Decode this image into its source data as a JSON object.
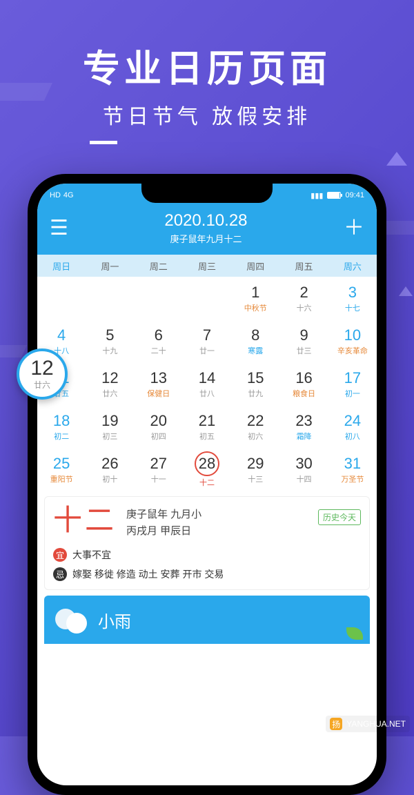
{
  "marketing": {
    "title": "专业日历页面",
    "subtitle": "节日节气 放假安排"
  },
  "statusbar": {
    "hd": "HD",
    "net": "4G",
    "time": "09:41"
  },
  "header": {
    "date": "2020.10.28",
    "lunar": "庚子鼠年九月十二"
  },
  "weekdays": [
    "周日",
    "周一",
    "周二",
    "周三",
    "周四",
    "周五",
    "周六"
  ],
  "badge": {
    "num": "12",
    "sub": "廿六"
  },
  "calendar": [
    {
      "n": "",
      "s": ""
    },
    {
      "n": "",
      "s": ""
    },
    {
      "n": "",
      "s": ""
    },
    {
      "n": "",
      "s": ""
    },
    {
      "n": "1",
      "s": "中秋节",
      "cls": "highlight"
    },
    {
      "n": "2",
      "s": "十六"
    },
    {
      "n": "3",
      "s": "十七",
      "wkend": true
    },
    {
      "n": "4",
      "s": "十八",
      "wkend": true
    },
    {
      "n": "5",
      "s": "十九"
    },
    {
      "n": "6",
      "s": "二十"
    },
    {
      "n": "7",
      "s": "廿一"
    },
    {
      "n": "8",
      "s": "寒露",
      "cls": "solar"
    },
    {
      "n": "9",
      "s": "廿三"
    },
    {
      "n": "10",
      "s": "辛亥革命",
      "cls": "highlight",
      "wkend": true
    },
    {
      "n": "11",
      "s": "廿五",
      "wkend": true
    },
    {
      "n": "12",
      "s": "廿六"
    },
    {
      "n": "13",
      "s": "保健日",
      "cls": "highlight"
    },
    {
      "n": "14",
      "s": "廿八"
    },
    {
      "n": "15",
      "s": "廿九"
    },
    {
      "n": "16",
      "s": "粮食日",
      "cls": "highlight"
    },
    {
      "n": "17",
      "s": "初一",
      "wkend": true
    },
    {
      "n": "18",
      "s": "初二",
      "wkend": true
    },
    {
      "n": "19",
      "s": "初三"
    },
    {
      "n": "20",
      "s": "初四"
    },
    {
      "n": "21",
      "s": "初五"
    },
    {
      "n": "22",
      "s": "初六"
    },
    {
      "n": "23",
      "s": "霜降",
      "cls": "solar"
    },
    {
      "n": "24",
      "s": "初八",
      "wkend": true
    },
    {
      "n": "25",
      "s": "重阳节",
      "cls": "highlight",
      "wkend": true
    },
    {
      "n": "26",
      "s": "初十"
    },
    {
      "n": "27",
      "s": "十一"
    },
    {
      "n": "28",
      "s": "十二",
      "today": true
    },
    {
      "n": "29",
      "s": "十三"
    },
    {
      "n": "30",
      "s": "十四"
    },
    {
      "n": "31",
      "s": "万圣节",
      "cls": "highlight",
      "wkend": true
    }
  ],
  "daily": {
    "bigLunar": "十二",
    "line1": "庚子鼠年 九月小",
    "line2": "丙戌月 甲辰日",
    "historyBtn": "历史今天",
    "yiLabel": "宜",
    "yi": "大事不宜",
    "jiLabel": "忌",
    "ji": "嫁娶 移徙 修造 动土 安葬 开市 交易"
  },
  "weather": {
    "text": "小雨"
  },
  "watermark": "YANGHUA.NET"
}
